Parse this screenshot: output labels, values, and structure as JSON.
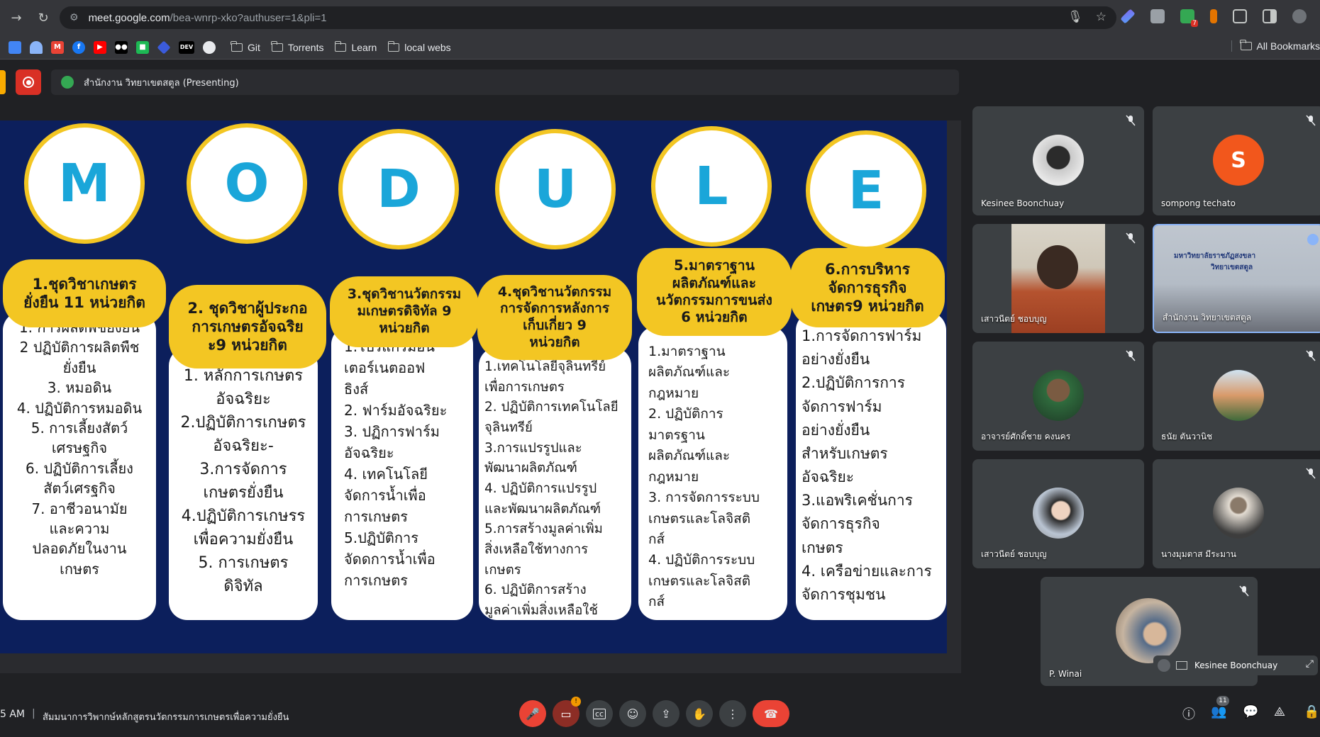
{
  "browser": {
    "url_host": "meet.google.com",
    "url_path": "/bea-wnrp-xko?authuser=1&pli=1",
    "bookmarks": [
      "Git",
      "Torrents",
      "Learn",
      "local webs"
    ],
    "bookmark_icon_dev": "DEV",
    "all_bookmarks": "All Bookmarks",
    "ext_badge": "7"
  },
  "meet": {
    "presenter": "สำนักงาน วิทยาเขตสตูล (Presenting)",
    "time": "5 AM",
    "separator": "|",
    "meeting_title": "สัมมนาการวิพากษ์หลักสูตรนวัตกรรมการเกษตรเพื่อความยั่งยืน",
    "cam_badge": "!",
    "people_count": "11"
  },
  "slide": {
    "letters": [
      "M",
      "O",
      "D",
      "U",
      "L",
      "E"
    ],
    "columns": [
      {
        "head": [
          "1.ชุดวิชาเกษตร",
          "ยั่งยืน 11 หน่วยกิต"
        ],
        "body": [
          "1. การผลิตพืชยั่งยืน",
          "2 ปฏิบัติการผลิตพืช",
          "ยั่งยืน",
          "3. หมอดิน",
          "4. ปฏิบัติการหมอดิน",
          "5. การเลี้ยงสัตว์",
          "เศรษฐกิจ",
          "6. ปฏิบัติการเลี้ยง",
          "สัตว์เศรฐกิจ",
          "7. อาชีวอนามัย",
          "และความ",
          "ปลอดภัยในงาน",
          "เกษตร"
        ]
      },
      {
        "head": [
          "2. ชุดวิชาผู้ประกอ",
          "การเกษตรอัจฉริย",
          "ะ9 หน่วยกิต"
        ],
        "body": [
          "1. หลักการเกษตร",
          "อัจฉริยะ",
          "2.ปฏิบัติการเกษตร",
          "อัจฉริยะ-",
          "3.การจัดการ",
          "เกษตรยั่งยืน",
          "4.ปฏิบัติการเกษรร",
          "เพื่อความยั่งยืน",
          "5. การเกษตร",
          "ดิจิทัล"
        ]
      },
      {
        "head": [
          "3.ชุดวิชานวัตกรรม",
          "มเกษตรดิจิทัล 9",
          "หน่วยกิต"
        ],
        "body": [
          "1.โปรแกรมอน",
          "เตอร์เนตออฟ",
          "ธิงส์",
          "2. ฟาร์มอัจฉริยะ",
          "3. ปฏิการฟาร์ม",
          "อัจฉริยะ",
          "4. เทคโนโลยี",
          "จัดการน้ำเพื่อ",
          "การเกษตร",
          "5.ปฏิบัติการ",
          "จัดดการน้ำเพื่อ",
          "การเกษตร"
        ]
      },
      {
        "head": [
          "4.ชุดวิชานวัตกรรม",
          "การจัดการหลังการ",
          "เก็บเกี่ยว 9",
          "หน่วยกิต"
        ],
        "body": [
          "1.เทคโนโลยีจุลินทรีย์",
          "เพื่อการเกษตร",
          "2. ปฏิบัติการเทคโนโลยี",
          "จุลินทรีย์",
          "3.การแปรรูปและ",
          "พัฒนาผลิตภัณฑ์",
          "4. ปฏิบัติการแปรรูป",
          "และพัฒนาผลิตภัณฑ์",
          "5.การสร้างมูลค่าเพิ่ม",
          "สิ่งเหลือใช้ทางการ",
          "เกษตร",
          "6. ปฏิบัติการสร้าง",
          "มูลค่าเพิ่มสิ่งเหลือใช้"
        ]
      },
      {
        "head": [
          "5.มาตราฐาน",
          "ผลิตภัณฑ์และ",
          "นวัตกรรมการขนส่ง",
          "6 หน่วยกิต"
        ],
        "body": [
          "1.มาตราฐาน",
          "ผลิตภัณฑ์และ",
          "กฎหมาย",
          "2. ปฏิบัติการ",
          "มาตรฐาน",
          "ผลิตภัณฑ์และ",
          "กฎหมาย",
          "3. การจัดการระบบ",
          "เกษตรและโลจิสติ",
          "กส์",
          "4. ปฏิบัติการระบบ",
          "เกษตรและโลจิสติ",
          "กส์"
        ]
      },
      {
        "head": [
          "6.การบริหาร",
          "จัดการธุรกิจ",
          "เกษตร9 หน่วยกิต"
        ],
        "body": [
          "1.การจัดการฟาร์ม",
          "อย่างยั่งยืน",
          "2.ปฏิบัติการการ",
          "จัดการฟาร์ม",
          "อย่างยั่งยืน",
          "สำหรับเกษตร",
          "อัจฉริยะ",
          "3.แอพริเคชั่นการ",
          "จัดการธุรกิจ",
          "เกษตร",
          "4. เครือข่ายและการ",
          "จัดการชุมชน"
        ]
      }
    ]
  },
  "participants": [
    {
      "name": "Kesinee Boonchuay"
    },
    {
      "name": "sompong techato",
      "initial": "S"
    },
    {
      "name": "เสาวนีตย์ ชอบบุญ"
    },
    {
      "name": "สำนักงาน วิทยาเขตสตูล",
      "screen_text": [
        "มหาวิทยาลัยราชภัฏสงขลา",
        "วิทยาเขตสตูล"
      ]
    },
    {
      "name": "อาจารย์ศักดิ์ชาย คงนคร"
    },
    {
      "name": "ธนัย ตันวานิช"
    },
    {
      "name": "เสาวนีตย์ ชอบบุญ"
    },
    {
      "name": "นางมุมตาส มีระมาน"
    },
    {
      "name": "P. Winai",
      "pip_name": "Kesinee Boonchuay"
    }
  ],
  "colors": {
    "slide_bg": "#0c1f5c",
    "yellow": "#f3c623",
    "letter_blue": "#1aa6d9",
    "meet_red": "#ea4335"
  }
}
